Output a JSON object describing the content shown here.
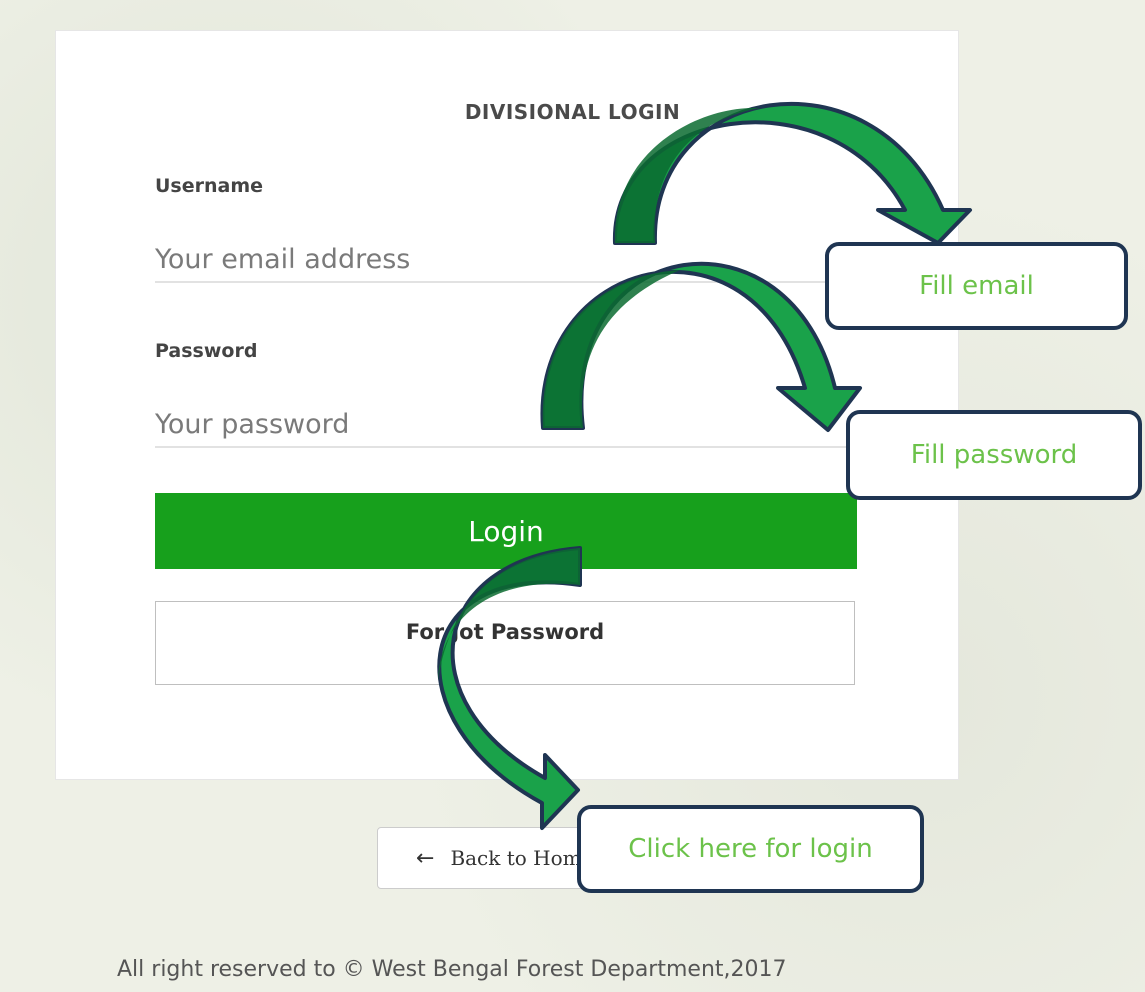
{
  "form": {
    "title": "DIVISIONAL LOGIN",
    "username_label": "Username",
    "username_placeholder": "Your email address",
    "password_label": "Password",
    "password_placeholder": "Your password",
    "login_button": "Login",
    "forgot_button": "Forgot Password"
  },
  "back_button": {
    "label": "Back to Home",
    "icon": "arrow-left-icon"
  },
  "footer": {
    "text": "All right reserved to © West Bengal Forest Department,2017"
  },
  "annotations": {
    "fill_email": "Fill email",
    "fill_password": "Fill password",
    "click_login": "Click here for login"
  },
  "colors": {
    "login_green": "#17a01c",
    "arrow_green": "#1aa24a",
    "arrow_dark": "#0b6b30",
    "callout_border": "#1f3552",
    "callout_text": "#6cc24a"
  }
}
